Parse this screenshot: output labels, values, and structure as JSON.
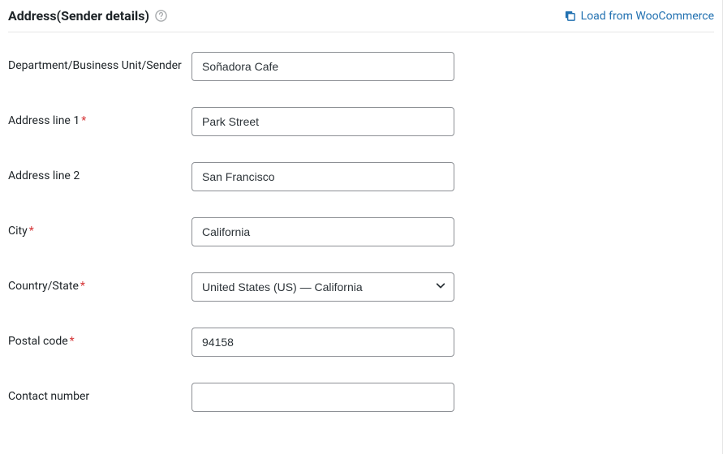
{
  "header": {
    "title": "Address(Sender details)",
    "load_link_label": "Load from WooCommerce"
  },
  "fields": {
    "department": {
      "label": "Department/Business Unit/Sender",
      "required": false,
      "value": "Soñadora Cafe"
    },
    "address1": {
      "label": "Address line 1",
      "required": true,
      "value": "Park Street"
    },
    "address2": {
      "label": "Address line 2",
      "required": false,
      "value": "San Francisco"
    },
    "city": {
      "label": "City",
      "required": true,
      "value": "California"
    },
    "country_state": {
      "label": "Country/State",
      "required": true,
      "value": "United States (US) — California"
    },
    "postal": {
      "label": "Postal code",
      "required": true,
      "value": "94158"
    },
    "contact": {
      "label": "Contact number",
      "required": false,
      "value": ""
    }
  }
}
